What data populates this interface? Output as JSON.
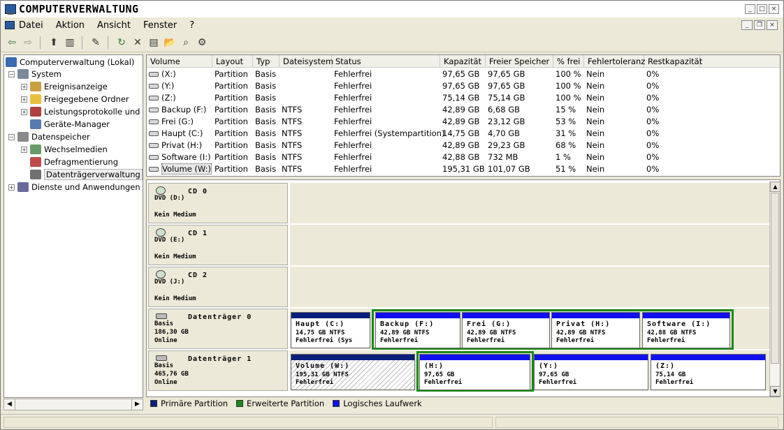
{
  "window": {
    "title": "COMPUTERVERWALTUNG"
  },
  "menu": {
    "items": [
      "Datei",
      "Aktion",
      "Ansicht",
      "Fenster",
      "?"
    ]
  },
  "tree": {
    "root": "Computerverwaltung (Lokal)",
    "system": "System",
    "ereignis": "Ereignisanzeige",
    "ordner": "Freigegebene Ordner",
    "leistung": "Leistungsprotokolle und Wa",
    "geraete": "Geräte-Manager",
    "datenspeicher": "Datenspeicher",
    "wechsel": "Wechselmedien",
    "defrag": "Defragmentierung",
    "datentraeger": "Datenträgerverwaltung",
    "dienste": "Dienste und Anwendungen"
  },
  "columns": [
    "Volume",
    "Layout",
    "Typ",
    "Dateisystem",
    "Status",
    "Kapazität",
    "Freier Speicher",
    "% frei",
    "Fehlertoleranz",
    "Restkapazität"
  ],
  "volumes": [
    {
      "volume": "(X:)",
      "layout": "Partition",
      "typ": "Basis",
      "fs": "",
      "status": "Fehlerfrei",
      "kap": "97,65 GB",
      "frei": "97,65 GB",
      "pct": "100 %",
      "fehler": "Nein",
      "rest": "0%"
    },
    {
      "volume": "(Y:)",
      "layout": "Partition",
      "typ": "Basis",
      "fs": "",
      "status": "Fehlerfrei",
      "kap": "97,65 GB",
      "frei": "97,65 GB",
      "pct": "100 %",
      "fehler": "Nein",
      "rest": "0%"
    },
    {
      "volume": "(Z:)",
      "layout": "Partition",
      "typ": "Basis",
      "fs": "",
      "status": "Fehlerfrei",
      "kap": "75,14 GB",
      "frei": "75,14 GB",
      "pct": "100 %",
      "fehler": "Nein",
      "rest": "0%"
    },
    {
      "volume": "Backup (F:)",
      "layout": "Partition",
      "typ": "Basis",
      "fs": "NTFS",
      "status": "Fehlerfrei",
      "kap": "42,89 GB",
      "frei": "6,68 GB",
      "pct": "15 %",
      "fehler": "Nein",
      "rest": "0%"
    },
    {
      "volume": "Frei (G:)",
      "layout": "Partition",
      "typ": "Basis",
      "fs": "NTFS",
      "status": "Fehlerfrei",
      "kap": "42,89 GB",
      "frei": "23,12 GB",
      "pct": "53 %",
      "fehler": "Nein",
      "rest": "0%"
    },
    {
      "volume": "Haupt (C:)",
      "layout": "Partition",
      "typ": "Basis",
      "fs": "NTFS",
      "status": "Fehlerfrei (Systempartition)",
      "kap": "14,75 GB",
      "frei": "4,70 GB",
      "pct": "31 %",
      "fehler": "Nein",
      "rest": "0%"
    },
    {
      "volume": "Privat (H:)",
      "layout": "Partition",
      "typ": "Basis",
      "fs": "NTFS",
      "status": "Fehlerfrei",
      "kap": "42,89 GB",
      "frei": "29,23 GB",
      "pct": "68 %",
      "fehler": "Nein",
      "rest": "0%"
    },
    {
      "volume": "Software (I:)",
      "layout": "Partition",
      "typ": "Basis",
      "fs": "NTFS",
      "status": "Fehlerfrei",
      "kap": "42,88 GB",
      "frei": "732 MB",
      "pct": "1 %",
      "fehler": "Nein",
      "rest": "0%"
    },
    {
      "volume": "Volume (W:)",
      "layout": "Partition",
      "typ": "Basis",
      "fs": "NTFS",
      "status": "Fehlerfrei",
      "kap": "195,31 GB",
      "frei": "101,07 GB",
      "pct": "51 %",
      "fehler": "Nein",
      "rest": "0%"
    }
  ],
  "disks": [
    {
      "name": "CD 0",
      "type": "DVD (D:)",
      "line2": "",
      "line3": "Kein Medium"
    },
    {
      "name": "CD 1",
      "type": "DVD (E:)",
      "line2": "",
      "line3": "Kein Medium"
    },
    {
      "name": "CD 2",
      "type": "DVD (J:)",
      "line2": "",
      "line3": "Kein Medium"
    },
    {
      "name": "Datenträger 0",
      "type": "Basis",
      "line2": "186,30 GB",
      "line3": "Online"
    },
    {
      "name": "Datenträger 1",
      "type": "Basis",
      "line2": "465,76 GB",
      "line3": "Online"
    }
  ],
  "partitions0": [
    {
      "t1": "Haupt   (C:)",
      "t2": "14,75 GB NTFS",
      "t3": "Fehlerfrei (Sys"
    },
    {
      "t1": "Backup   (F:)",
      "t2": "42,89 GB NTFS",
      "t3": "Fehlerfrei"
    },
    {
      "t1": "Frei   (G:)",
      "t2": "42,89 GB NTFS",
      "t3": "Fehlerfrei"
    },
    {
      "t1": "Privat   (H:)",
      "t2": "42,89 GB NTFS",
      "t3": "Fehlerfrei"
    },
    {
      "t1": "Software   (I:)",
      "t2": "42,88 GB NTFS",
      "t3": "Fehlerfrei"
    }
  ],
  "partitions1": [
    {
      "t1": "Volume   (W:)",
      "t2": "195,31 GB NTFS",
      "t3": "Fehlerfrei"
    },
    {
      "t1": "(H:)",
      "t2": "97,65 GB",
      "t3": "Fehlerfrei"
    },
    {
      "t1": "(Y:)",
      "t2": "97,65 GB",
      "t3": "Fehlerfrei"
    },
    {
      "t1": "(Z:)",
      "t2": "75,14 GB",
      "t3": "Fehlerfrei"
    }
  ],
  "legend": [
    "Primäre Partition",
    "Erweiterte Partition",
    "Logisches Laufwerk"
  ],
  "colors": {
    "primary": "#0a1f7a",
    "extended": "#1a8a1a",
    "logical": "#1010ee"
  }
}
